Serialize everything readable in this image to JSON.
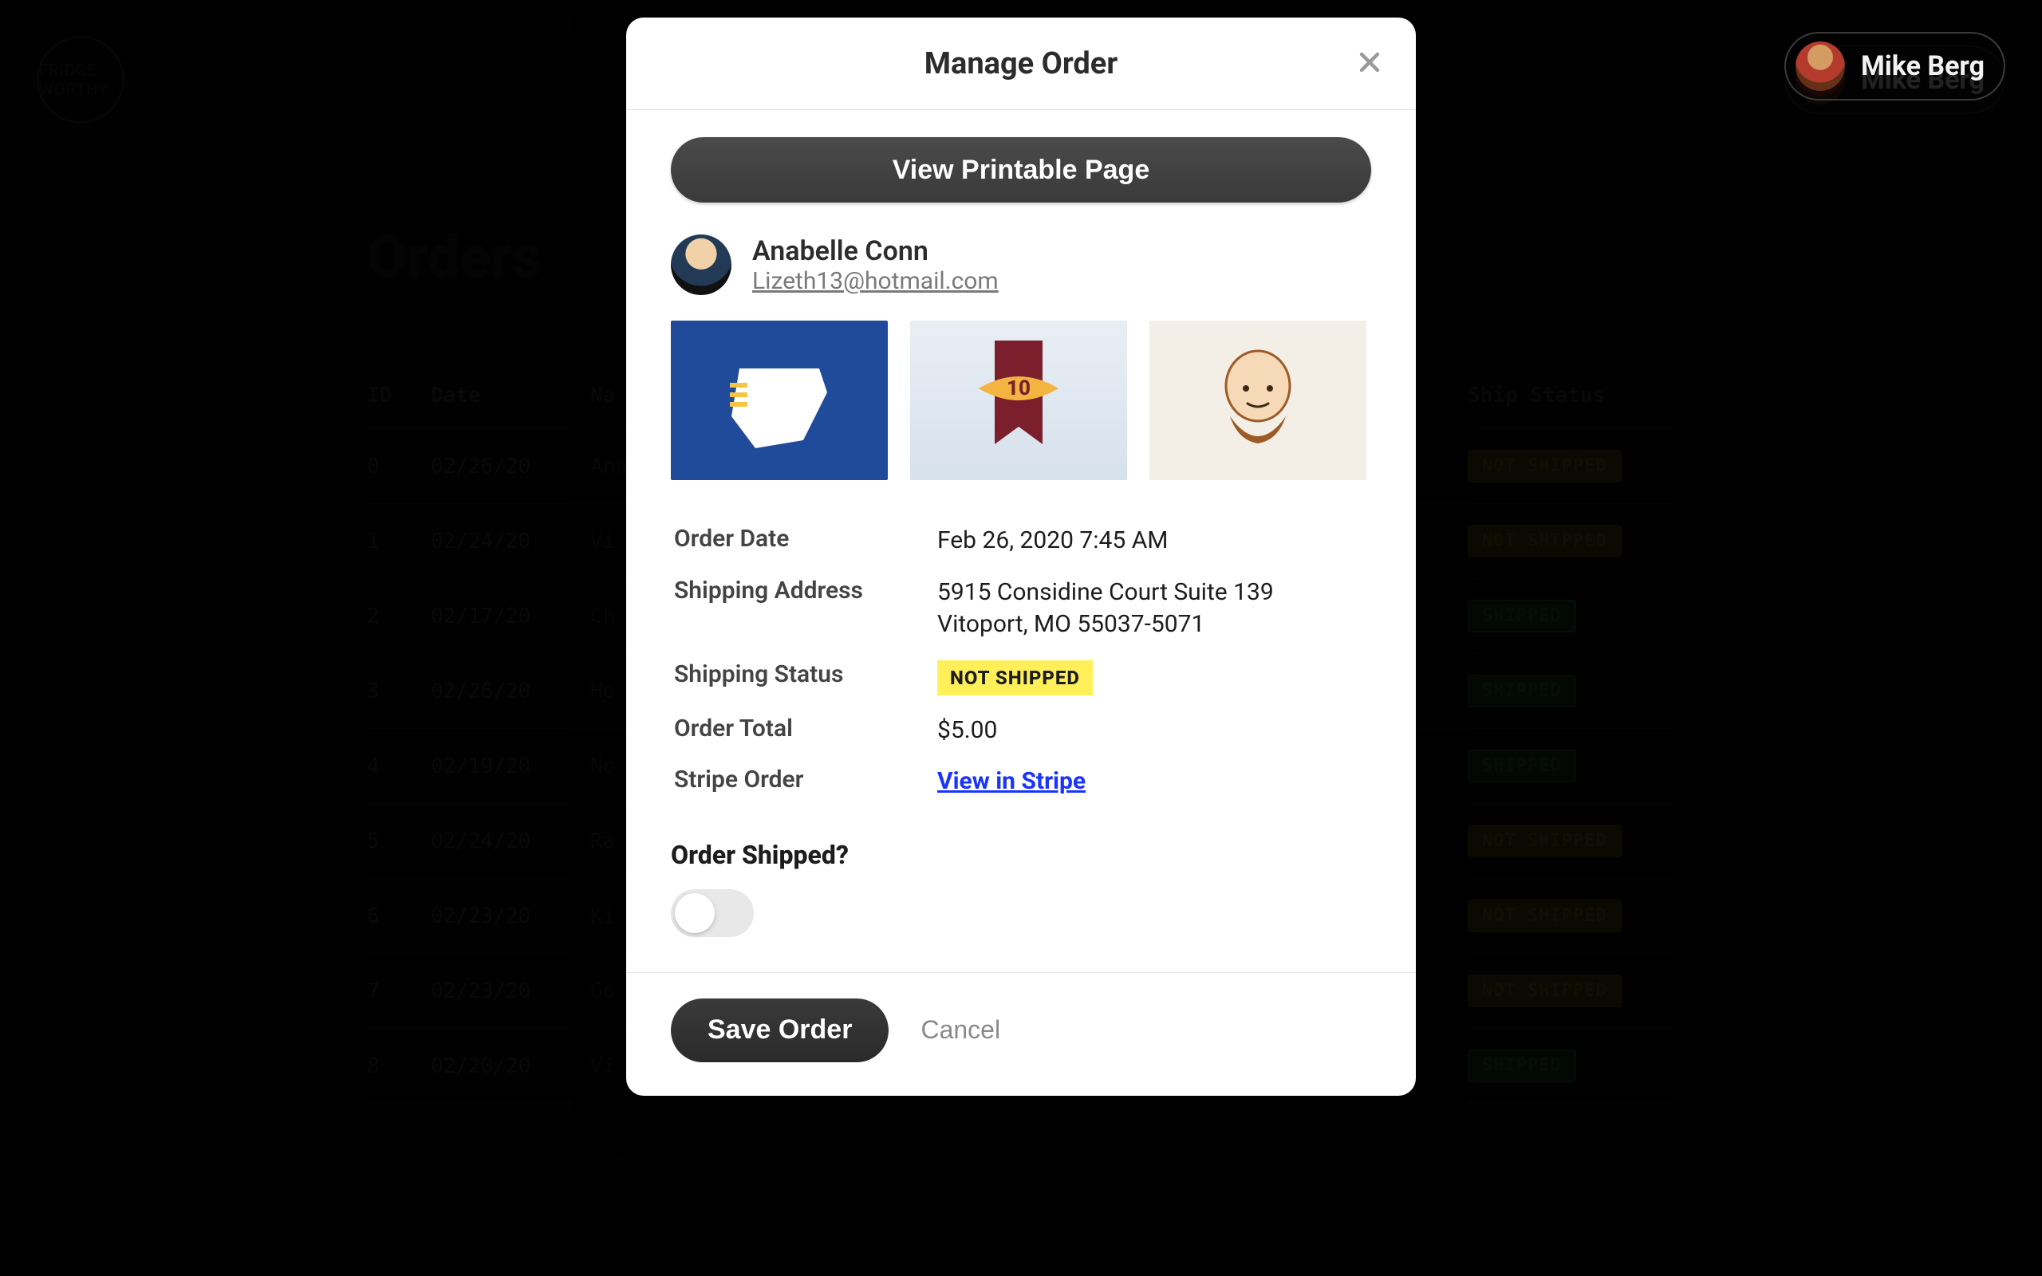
{
  "header": {
    "brand": "FRIDGE WORTHY",
    "user_name": "Mike Berg"
  },
  "page": {
    "title": "Orders",
    "columns": {
      "id": "ID",
      "date": "Date",
      "name": "Na",
      "status": "Ship Status"
    },
    "rows": [
      {
        "id": "0",
        "date": "02/26/20",
        "name": "Ana",
        "status": "NOT SHIPPED",
        "status_code": "ns"
      },
      {
        "id": "1",
        "date": "02/24/20",
        "name": "Vi",
        "status": "NOT SHIPPED",
        "status_code": "ns"
      },
      {
        "id": "2",
        "date": "02/17/20",
        "name": "Ch",
        "status": "SHIPPED",
        "status_code": "sh"
      },
      {
        "id": "3",
        "date": "02/26/20",
        "name": "Ho",
        "status": "SHIPPED",
        "status_code": "sh"
      },
      {
        "id": "4",
        "date": "02/19/20",
        "name": "No",
        "status": "SHIPPED",
        "status_code": "sh"
      },
      {
        "id": "5",
        "date": "02/24/20",
        "name": "Ra",
        "status": "NOT SHIPPED",
        "status_code": "ns"
      },
      {
        "id": "6",
        "date": "02/23/20",
        "name": "Ki",
        "status": "NOT SHIPPED",
        "status_code": "ns"
      },
      {
        "id": "7",
        "date": "02/23/20",
        "name": "Go",
        "status": "NOT SHIPPED",
        "status_code": "ns"
      },
      {
        "id": "8",
        "date": "02/20/20",
        "name": "Vi",
        "status": "SHIPPED",
        "status_code": "sh"
      }
    ]
  },
  "modal": {
    "title": "Manage Order",
    "printable_label": "View Printable Page",
    "customer": {
      "name": "Anabelle Conn",
      "email": "Lizeth13@hotmail.com"
    },
    "labels": {
      "order_date": "Order Date",
      "shipping_address": "Shipping Address",
      "shipping_status": "Shipping Status",
      "order_total": "Order Total",
      "stripe_order": "Stripe Order",
      "order_shipped_q": "Order Shipped?"
    },
    "values": {
      "order_date": "Feb 26, 2020 7:45 AM",
      "shipping_address_line1": "5915 Considine Court Suite 139",
      "shipping_address_line2": "Vitoport, MO 55037-5071",
      "shipping_status": "NOT SHIPPED",
      "order_total": "$5.00",
      "stripe_link_text": "View in Stripe"
    },
    "shipped_toggle": false,
    "footer": {
      "save": "Save Order",
      "cancel": "Cancel"
    }
  }
}
